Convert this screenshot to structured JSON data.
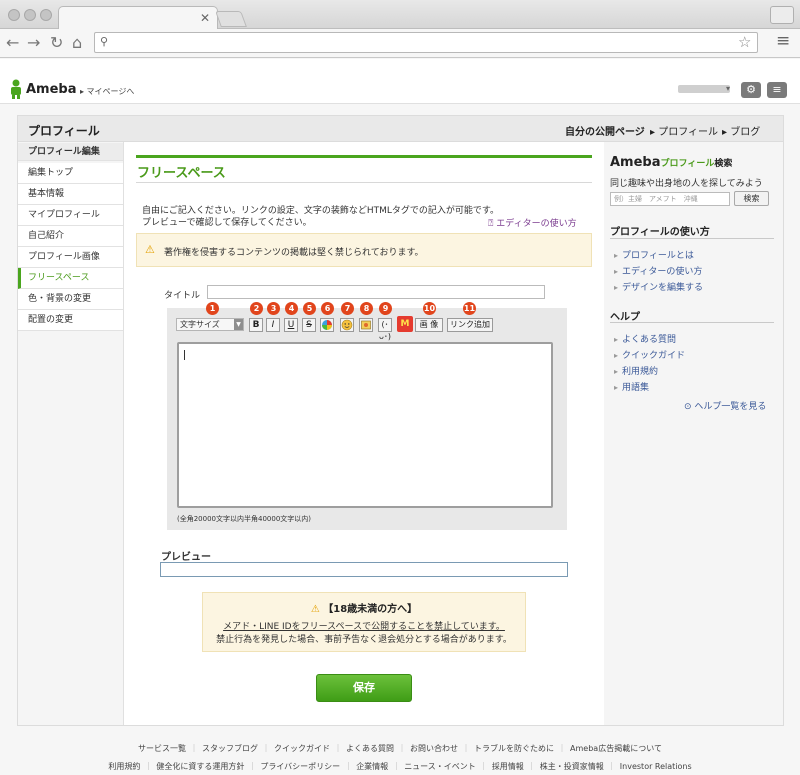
{
  "browser": {
    "address": ""
  },
  "header": {
    "logo": "Ameba",
    "mypage_link": "▸ マイページへ"
  },
  "page": {
    "title": "プロフィール",
    "top_nav": [
      "自分の公開ページ",
      "▸ プロフィール",
      "▸ ブログ"
    ]
  },
  "sidebar": {
    "heading": "プロフィール編集",
    "items": [
      "編集トップ",
      "基本情報",
      "マイプロフィール",
      "自己紹介",
      "プロフィール画像",
      "フリースペース",
      "色・背景の変更",
      "配置の変更"
    ],
    "active_index": 5
  },
  "main": {
    "heading": "フリースペース",
    "desc_line1": "自由にご記入ください。リンクの設定、文字の装飾などHTMLタグでの記入が可能です。",
    "desc_line2": "プレビューで確認して保存してください。",
    "editor_help": "エディターの使い方",
    "warning": "著作権を侵害するコンテンツの掲載は堅く禁じられております。",
    "title_label": "タイトル",
    "title_value": "",
    "toolbar_numbers": [
      "1",
      "2",
      "3",
      "4",
      "5",
      "6",
      "7",
      "8",
      "9",
      "10",
      "11"
    ],
    "font_size_label": "文字サイズ",
    "toolbar_buttons": [
      "B",
      "I",
      "U",
      "S"
    ],
    "image_button": "画 像",
    "link_button": "リンク追加",
    "char_limit": "(全角20000文字以内半角40000文字以内)",
    "preview_label": "プレビュー",
    "notice_title": "【18歳未満の方へ】",
    "notice_line1": "メアド・LINE IDをフリースペースで公開することを禁止しています。",
    "notice_line2": "禁止行為を発見した場合、事前予告なく退会処分とする場合があります。",
    "save_label": "保存"
  },
  "right": {
    "search_title_main": "Ameba",
    "search_title_green": "プロフィール",
    "search_title_end": "検索",
    "search_sub": "同じ趣味や出身地の人を探してみよう",
    "search_placeholder": "例）主婦　アメフト　沖縄",
    "search_button": "検索",
    "howto_heading": "プロフィールの使い方",
    "howto_links": [
      "プロフィールとは",
      "エディターの使い方",
      "デザインを編集する"
    ],
    "help_heading": "ヘルプ",
    "help_links": [
      "よくある質問",
      "クイックガイド",
      "利用規約",
      "用語集"
    ],
    "help_all": "ヘルプ一覧を見る"
  },
  "footer": {
    "row1": [
      "サービス一覧",
      "スタッフブログ",
      "クイックガイド",
      "よくある質問",
      "お問い合わせ",
      "トラブルを防ぐために",
      "Ameba広告掲載について"
    ],
    "row2": [
      "利用規約",
      "健全化に資する運用方針",
      "プライバシーポリシー",
      "企業情報",
      "ニュース・イベント",
      "採用情報",
      "株主・投資家情報",
      "Investor Relations"
    ]
  },
  "colors": {
    "accent_green": "#4aa51e",
    "number_badge": "#e1451c",
    "link": "#3b5998"
  }
}
